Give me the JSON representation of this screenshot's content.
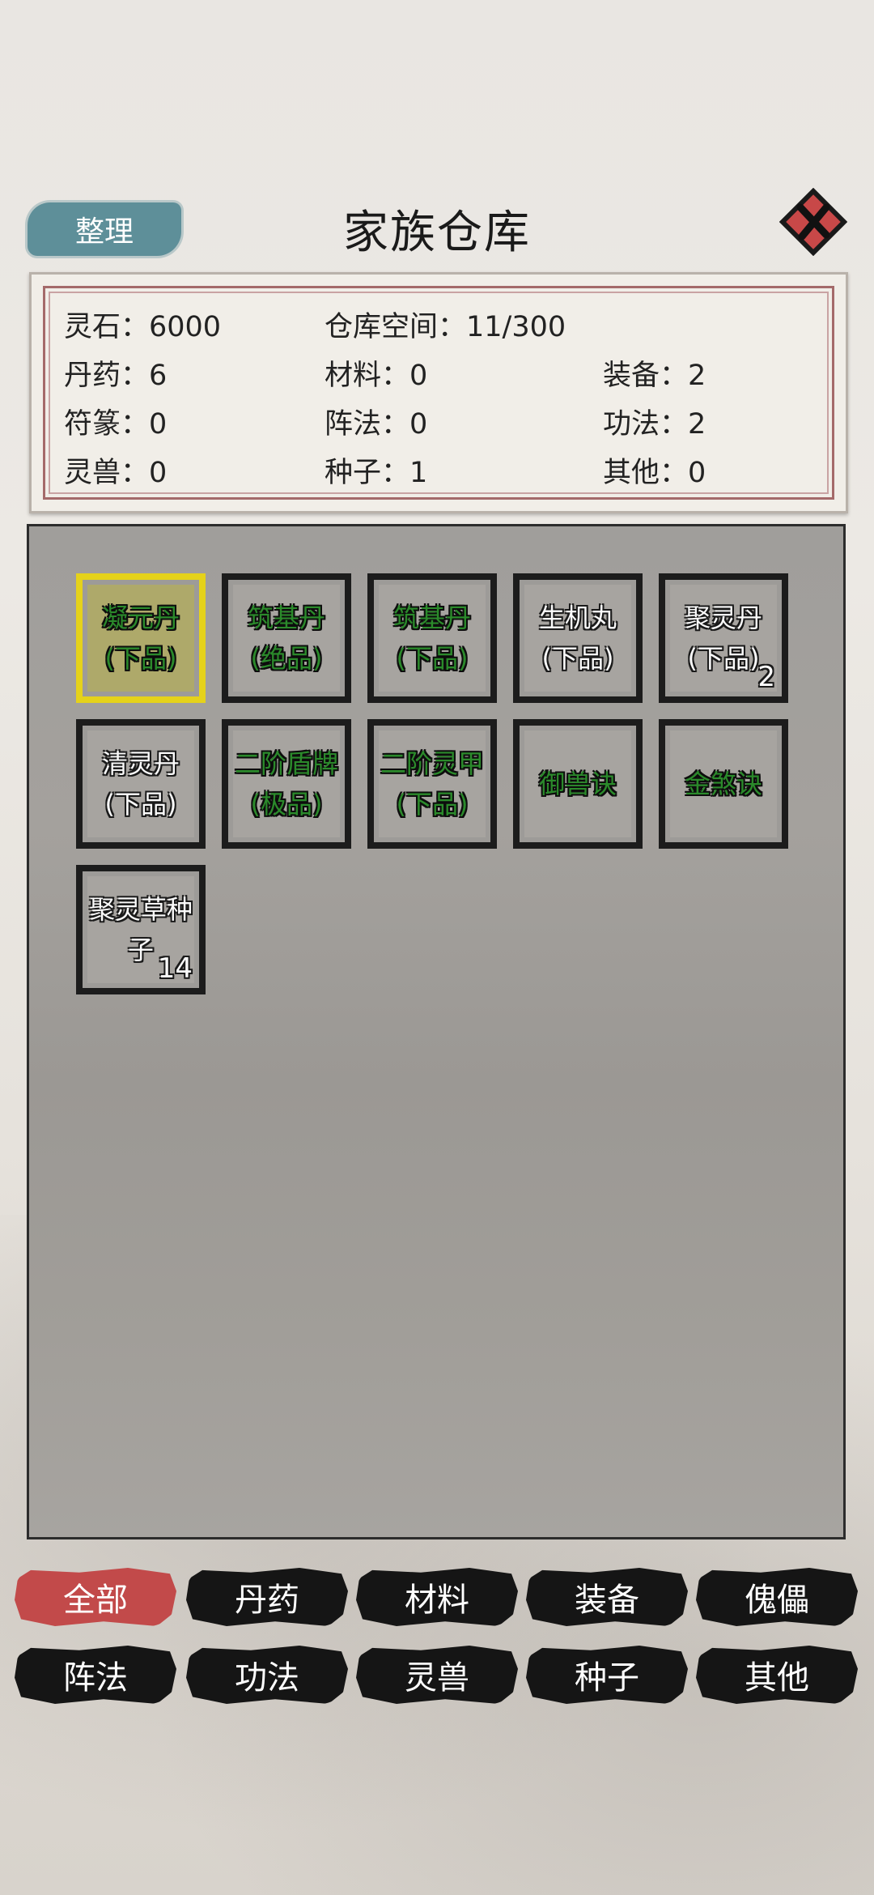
{
  "header": {
    "sort_label": "整理",
    "title": "家族仓库",
    "close_icon": "close-icon"
  },
  "stats": {
    "spirit_stone": "灵石：6000",
    "capacity": "仓库空间：11/300",
    "pills": "丹药：6",
    "materials": "材料：0",
    "equipment": "装备：2",
    "talismans": "符篆：0",
    "formations": "阵法：0",
    "techniques": "功法：2",
    "beasts": "灵兽：0",
    "seeds": "种子：1",
    "others": "其他：0"
  },
  "items": [
    {
      "line1": "凝元丹",
      "line2": "(下品)",
      "color": "green",
      "selected": true,
      "count": ""
    },
    {
      "line1": "筑基丹",
      "line2": "(绝品)",
      "color": "green",
      "selected": false,
      "count": ""
    },
    {
      "line1": "筑基丹",
      "line2": "(下品)",
      "color": "green",
      "selected": false,
      "count": ""
    },
    {
      "line1": "生机丸",
      "line2": "(下品)",
      "color": "white",
      "selected": false,
      "count": ""
    },
    {
      "line1": "聚灵丹",
      "line2": "(下品)",
      "color": "white",
      "selected": false,
      "count": "2"
    },
    {
      "line1": "清灵丹",
      "line2": "(下品)",
      "color": "white",
      "selected": false,
      "count": ""
    },
    {
      "line1": "二阶盾牌",
      "line2": "(极品)",
      "color": "green",
      "selected": false,
      "count": ""
    },
    {
      "line1": "二阶灵甲",
      "line2": "(下品)",
      "color": "green",
      "selected": false,
      "count": ""
    },
    {
      "line1": "御兽诀",
      "line2": "",
      "color": "green",
      "selected": false,
      "count": ""
    },
    {
      "line1": "金煞诀",
      "line2": "",
      "color": "green",
      "selected": false,
      "count": ""
    },
    {
      "line1": "聚灵草种",
      "line2": "子",
      "color": "white",
      "selected": false,
      "count": "14"
    }
  ],
  "tabs": [
    {
      "label": "全部",
      "active": true
    },
    {
      "label": "丹药",
      "active": false
    },
    {
      "label": "材料",
      "active": false
    },
    {
      "label": "装备",
      "active": false
    },
    {
      "label": "傀儡",
      "active": false
    },
    {
      "label": "阵法",
      "active": false
    },
    {
      "label": "功法",
      "active": false
    },
    {
      "label": "灵兽",
      "active": false
    },
    {
      "label": "种子",
      "active": false
    },
    {
      "label": "其他",
      "active": false
    }
  ],
  "colors": {
    "sort_button": "#5e8f99",
    "active_tab": "#c24a4a",
    "inactive_tab": "#151515",
    "selected_border": "#e5d21a",
    "item_green": "#2b8a2b",
    "close_red": "#c84848"
  }
}
